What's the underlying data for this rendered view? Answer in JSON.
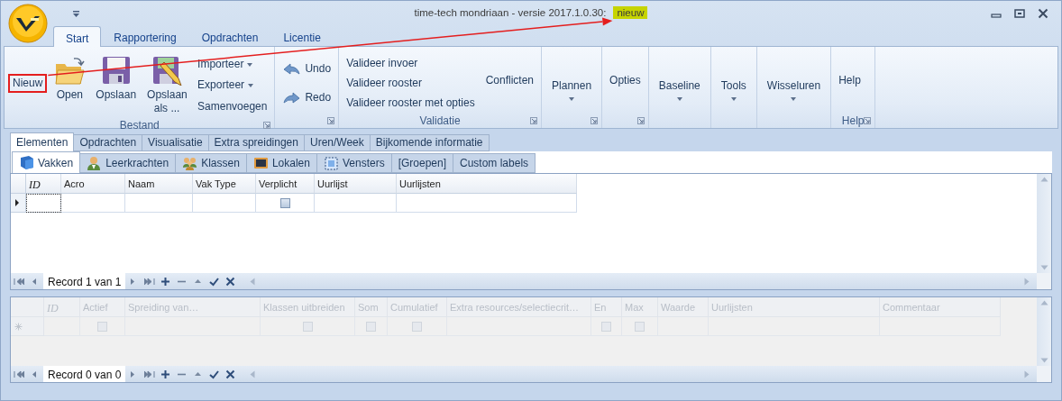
{
  "window": {
    "title": "time-tech mondriaan - versie 2017.1.0.30:",
    "title_highlight": "nieuw",
    "annotation_arrow": true
  },
  "ribbon_tabs": [
    {
      "label": "Start",
      "selected": true
    },
    {
      "label": "Rapportering",
      "selected": false
    },
    {
      "label": "Opdrachten",
      "selected": false
    },
    {
      "label": "Licentie",
      "selected": false
    }
  ],
  "ribbon_groups": [
    {
      "label": "Bestand",
      "launcher": true,
      "items": [
        {
          "kind": "text",
          "label": "Nieuw",
          "annotated": true
        },
        {
          "kind": "open",
          "label": "Open",
          "annotated": false
        },
        {
          "kind": "save",
          "label": "Opslaan",
          "annotated": false
        },
        {
          "kind": "save-as",
          "label": "Opslaan als ...",
          "annotated": false
        },
        {
          "kind": "menu",
          "label": "Importeer",
          "annotated": false
        },
        {
          "kind": "menu",
          "label": "Exporteer",
          "annotated": false
        },
        {
          "kind": "small",
          "label": "Samenvoegen",
          "annotated": false
        }
      ]
    },
    {
      "launcher": true,
      "items": [
        {
          "kind": "undo",
          "label": "Undo",
          "annotated": false
        },
        {
          "kind": "redo",
          "label": "Redo",
          "annotated": false
        }
      ]
    },
    {
      "label": "Validatie",
      "launcher": true,
      "items": [
        {
          "kind": "small",
          "label": "Valideer invoer",
          "annotated": false
        },
        {
          "kind": "small",
          "label": "Valideer rooster",
          "annotated": false
        },
        {
          "kind": "small",
          "label": "Valideer rooster met opties",
          "annotated": false
        },
        {
          "kind": "text",
          "label": "Conflicten",
          "annotated": false
        }
      ]
    },
    {
      "launcher": true,
      "items": [
        {
          "kind": "dropdown",
          "label": "Plannen",
          "annotated": false
        }
      ]
    },
    {
      "launcher": true,
      "items": [
        {
          "kind": "text",
          "label": "Opties",
          "annotated": false
        }
      ]
    },
    {
      "launcher": false,
      "items": [
        {
          "kind": "dropdown",
          "label": "Baseline",
          "annotated": false
        }
      ]
    },
    {
      "launcher": false,
      "items": [
        {
          "kind": "dropdown",
          "label": "Tools",
          "annotated": false
        }
      ]
    },
    {
      "launcher": false,
      "items": [
        {
          "kind": "dropdown",
          "label": "Wisseluren",
          "annotated": false
        }
      ]
    },
    {
      "label": "Help",
      "launcher": true,
      "items": [
        {
          "kind": "text",
          "label": "Help",
          "annotated": false
        }
      ]
    }
  ],
  "main_tabs": [
    {
      "label": "Elementen",
      "selected": true
    },
    {
      "label": "Opdrachten",
      "selected": false
    },
    {
      "label": "Visualisatie",
      "selected": false
    },
    {
      "label": "Extra spreidingen",
      "selected": false
    },
    {
      "label": "Uren/Week",
      "selected": false
    },
    {
      "label": "Bijkomende informatie",
      "selected": false
    }
  ],
  "sub_tabs": [
    {
      "label": "Vakken",
      "kind": "book",
      "selected": true
    },
    {
      "label": "Leerkrachten",
      "kind": "person",
      "selected": false
    },
    {
      "label": "Klassen",
      "kind": "people",
      "selected": false
    },
    {
      "label": "Lokalen",
      "kind": "monitor",
      "selected": false
    },
    {
      "label": "Vensters",
      "kind": "frame",
      "selected": false
    },
    {
      "label": "[Groepen]",
      "kind": "none",
      "selected": false
    },
    {
      "label": "Custom labels",
      "kind": "none",
      "selected": false
    }
  ],
  "grids": [
    {
      "disabled": false,
      "columns": [
        {
          "label": "ID",
          "italic": true
        },
        {
          "label": "Acro",
          "italic": false
        },
        {
          "label": "Naam",
          "italic": false
        },
        {
          "label": "Vak Type",
          "italic": false
        },
        {
          "label": "Verplicht",
          "italic": false
        },
        {
          "label": "Uurlijst",
          "italic": false
        },
        {
          "label": "Uurlijsten",
          "italic": false
        }
      ],
      "rows": [
        {
          "current": true,
          "cells": [
            {
              "kind": "empty"
            },
            {
              "kind": "empty"
            },
            {
              "kind": "empty"
            },
            {
              "kind": "empty"
            },
            {
              "kind": "checkbox",
              "checked": false
            },
            {
              "kind": "empty"
            },
            {
              "kind": "empty"
            }
          ]
        }
      ],
      "navigator": "Record 1 van 1"
    },
    {
      "disabled": true,
      "columns": [
        {
          "label": "ID",
          "italic": true
        },
        {
          "label": "Actief",
          "italic": false
        },
        {
          "label": "Spreiding van…",
          "italic": false
        },
        {
          "label": "Klassen uitbreiden",
          "italic": false
        },
        {
          "label": "Som",
          "italic": false
        },
        {
          "label": "Cumulatief",
          "italic": false
        },
        {
          "label": "Extra resources/selectiecrit…",
          "italic": false
        },
        {
          "label": "En",
          "italic": false
        },
        {
          "label": "Max",
          "italic": false
        },
        {
          "label": "Waarde",
          "italic": false
        },
        {
          "label": "Uurlijsten",
          "italic": false
        },
        {
          "label": "Commentaar",
          "italic": false
        }
      ],
      "rows": [
        {
          "current": false,
          "cells": [
            {
              "kind": "empty"
            },
            {
              "kind": "checkbox",
              "checked": false
            },
            {
              "kind": "empty"
            },
            {
              "kind": "checkbox",
              "checked": false
            },
            {
              "kind": "checkbox",
              "checked": false
            },
            {
              "kind": "checkbox",
              "checked": false
            },
            {
              "kind": "empty"
            },
            {
              "kind": "checkbox",
              "checked": false
            },
            {
              "kind": "checkbox",
              "checked": false
            },
            {
              "kind": "empty"
            },
            {
              "kind": "empty"
            },
            {
              "kind": "empty"
            }
          ]
        }
      ],
      "navigator": "Record 0 van 0"
    }
  ]
}
